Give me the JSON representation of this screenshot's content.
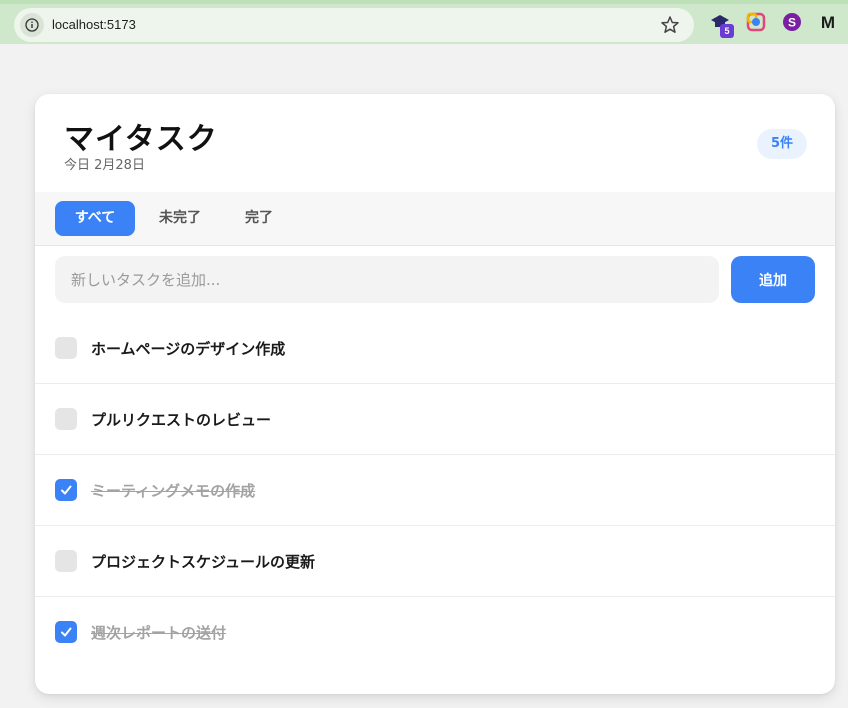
{
  "browser": {
    "url": "localhost:5173",
    "extension_badge": "5",
    "icons": [
      "info-icon",
      "bookmark-star-icon",
      "extension-graduation-icon",
      "extension-color-icon",
      "extension-s-icon",
      "extension-m-icon"
    ]
  },
  "app": {
    "title": "マイタスク",
    "date": "今日 2月28日",
    "count": "5件"
  },
  "tabs": [
    {
      "label": "すべて",
      "active": true
    },
    {
      "label": "未完了",
      "active": false
    },
    {
      "label": "完了",
      "active": false
    }
  ],
  "new_task": {
    "placeholder": "新しいタスクを追加...",
    "value": "",
    "add_label": "追加"
  },
  "tasks": [
    {
      "text": "ホームページのデザイン作成",
      "done": false
    },
    {
      "text": "プルリクエストのレビュー",
      "done": false
    },
    {
      "text": "ミーティングメモの作成",
      "done": true
    },
    {
      "text": "プロジェクトスケジュールの更新",
      "done": false
    },
    {
      "text": "週次レポートの送付",
      "done": true
    }
  ],
  "colors": {
    "accent": "#3b82f6",
    "badge_bg": "#eaf2fd",
    "done_text": "#a3a3a3"
  }
}
